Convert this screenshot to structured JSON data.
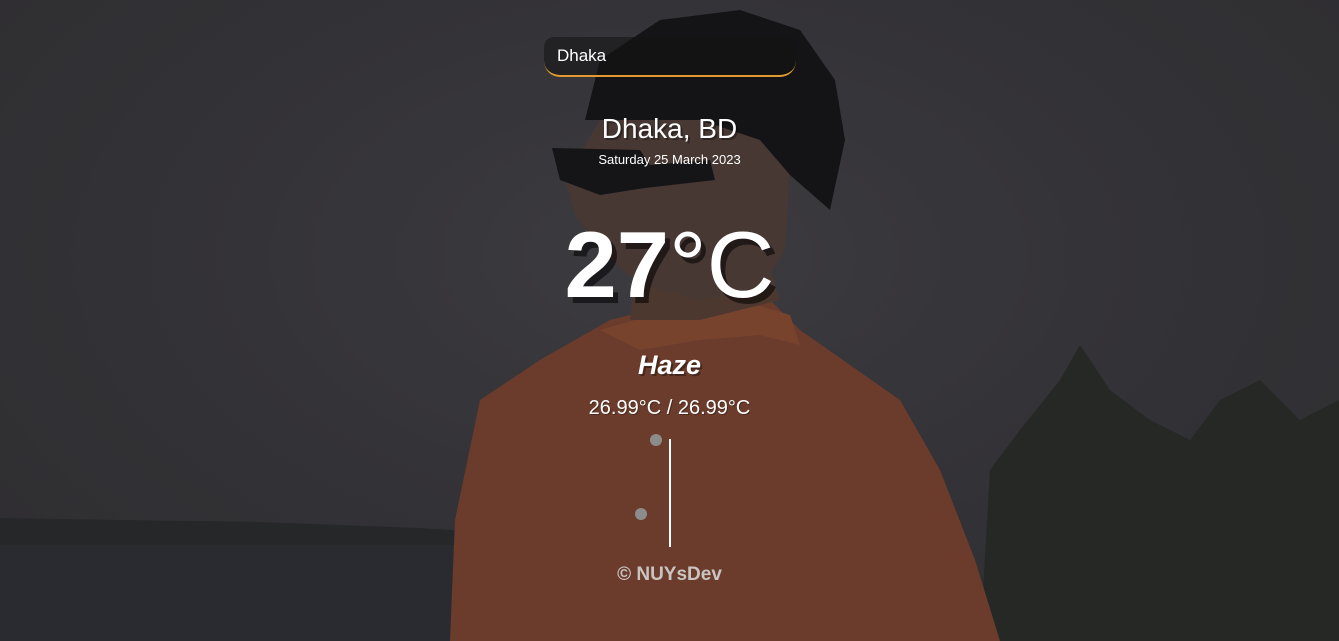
{
  "search": {
    "value": "Dhaka"
  },
  "location": {
    "city_country": "Dhaka, BD",
    "date": "Saturday 25 March 2023"
  },
  "weather": {
    "temp_value": "27",
    "temp_unit": "°C",
    "condition": "Haze",
    "hi_low": "26.99°C / 26.99°C"
  },
  "footer": {
    "credit": "© NUYsDev"
  },
  "colors": {
    "accent": "#e19b32",
    "background": "#3a393d",
    "shirt": "#8a4a30"
  }
}
